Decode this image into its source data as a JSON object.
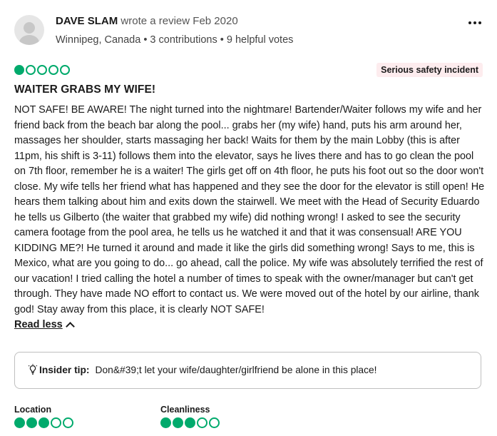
{
  "review": {
    "user_name": "DAVE SLAM",
    "wrote_text": "wrote a review Feb 2020",
    "meta": "Winnipeg, Canada • 3 contributions • 9 helpful votes",
    "rating": 1,
    "rating_max": 5,
    "badge": "Serious safety incident",
    "title": "WAITER GRABS MY WIFE!",
    "body": "NOT SAFE! BE AWARE! The night turned into the nightmare! Bartender/Waiter follows my wife and her friend back from the beach bar along the pool... grabs her (my wife) hand, puts his arm around her, massages her shoulder, starts massaging her back! Waits for them by the main Lobby (this is after 11pm, his shift is 3-11) follows them into the elevator, says he lives there and has to go clean the pool on 7th floor, remember he is a waiter! The girls get off on 4th floor, he puts his foot out so the door won't close. My wife tells her friend what has happened and they see the door for the elevator is still open! He hears them talking about him and exits down the stairwell. We meet with the Head of Security Eduardo he tells us Gilberto (the waiter that grabbed my wife) did nothing wrong! I asked to see the security camera footage from the pool area, he tells us he watched it and that it was consensual! ARE YOU KIDDING ME?! He turned it around and made it like the girls did something wrong! Says to me, this is Mexico, what are you going to do... go ahead, call the police. My wife was absolutely terrified the rest of our vacation! I tried calling the hotel a number of times to speak with the owner/manager but can't get through. They have made NO effort to contact us. We were moved out of the hotel by our airline, thank god! Stay away from this place, it is clearly NOT SAFE!",
    "read_less_label": "Read less",
    "insider_tip_label": "Insider tip:",
    "insider_tip_text": "Don&#39;t let your wife/daughter/girlfriend be alone in this place!",
    "sub_ratings": [
      {
        "label": "Location",
        "rating": 3,
        "max": 5
      },
      {
        "label": "Cleanliness",
        "rating": 3,
        "max": 5
      }
    ]
  },
  "colors": {
    "bubble": "#00aa6c",
    "badge_bg": "#fdecee"
  },
  "icons": {
    "more": "more-horizontal-icon",
    "insider_tip": "lightbulb-icon",
    "read_less": "chevron-up-icon"
  }
}
